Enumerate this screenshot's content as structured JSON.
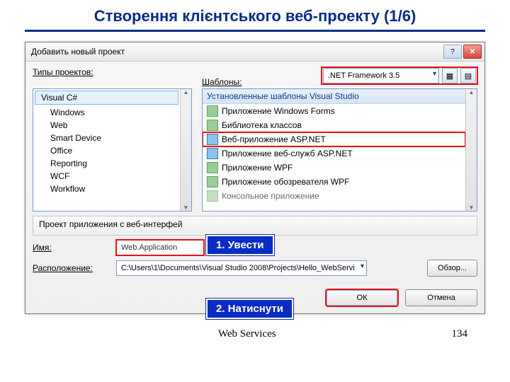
{
  "slide": {
    "title": "Створення клієнтського веб-проекту  (1/6)"
  },
  "dialog": {
    "title": "Добавить новый проект",
    "helpGlyph": "?",
    "closeGlyph": "✕",
    "typesLabel": "Типы проектов:",
    "templatesLabel": "Шаблоны:",
    "framework": ".NET Framework 3.5",
    "treeRoot": "Visual C#",
    "treeItems": [
      "Windows",
      "Web",
      "Smart Device",
      "Office",
      "Reporting",
      "WCF",
      "Workflow"
    ],
    "templatesHeader": "Установленные шаблоны Visual Studio",
    "templates": [
      "Приложение Windows Forms",
      "Библиотека классов",
      "Веб-приложение ASP.NET",
      "Приложение веб-служб ASP.NET",
      "Приложение WPF",
      "Приложение обозревателя WPF",
      "Консольное приложение"
    ],
    "description": "Проект приложения с веб-интерфей",
    "nameLabel": "Имя:",
    "nameValue": "Web.Application",
    "locationLabel": "Расположение:",
    "locationValue": "C:\\Users\\1\\Documents\\Visual Studio 2008\\Projects\\Hello_WebServi",
    "browse": "Обзор...",
    "ok": "ОК",
    "cancel": "Отмена"
  },
  "callouts": {
    "one": "1. Увести",
    "two": "2. Натиснути"
  },
  "footer": {
    "left": "Web Services",
    "right": "134"
  },
  "icons": {
    "viewSmall": "▦",
    "viewLarge": "▤"
  }
}
